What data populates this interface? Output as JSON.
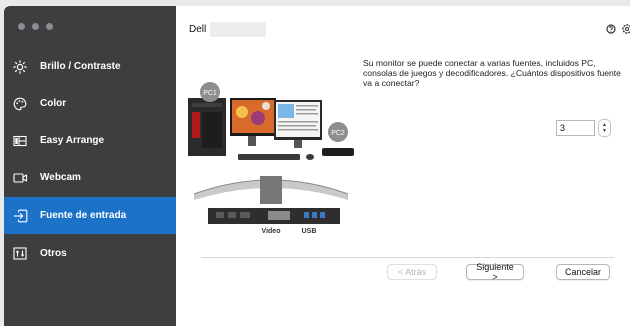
{
  "sidebar": {
    "items": [
      {
        "label": "Brillo / Contraste",
        "icon": "brightness-icon"
      },
      {
        "label": "Color",
        "icon": "palette-icon"
      },
      {
        "label": "Easy Arrange",
        "icon": "layout-icon"
      },
      {
        "label": "Webcam",
        "icon": "webcam-icon"
      },
      {
        "label": "Fuente de entrada",
        "icon": "input-source-icon",
        "active": true
      },
      {
        "label": "Otros",
        "icon": "others-icon"
      }
    ]
  },
  "header": {
    "title": "Dell"
  },
  "content": {
    "description": "Su monitor se puede conectar a varias fuentes, incluidos PC, consolas de juegos y decodificadores. ¿Cuántos dispositivos fuente va a conectar?",
    "device_count": "3",
    "pc1_label": "PC1",
    "pc2_label": "PC2",
    "port_video_label": "Video",
    "port_usb_label": "USB"
  },
  "footer": {
    "back_label": "< Atrás",
    "next_label": "Siguiente >",
    "cancel_label": "Cancelar"
  },
  "colors": {
    "accent": "#1b72c7",
    "sidebar": "#3c3e40"
  }
}
